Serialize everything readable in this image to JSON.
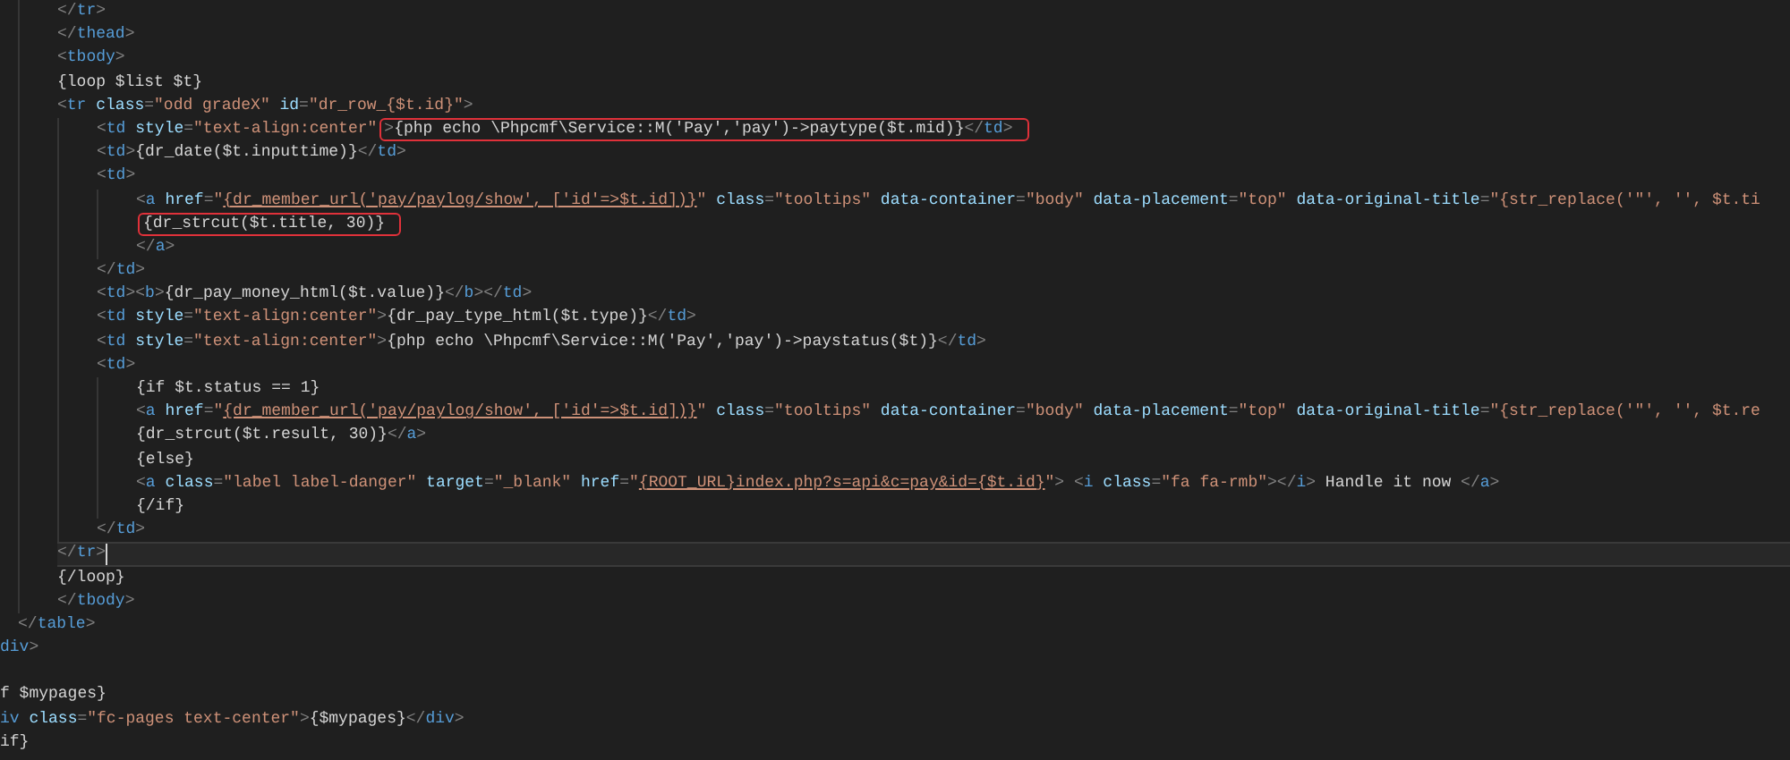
{
  "editor": {
    "lines": [
      {
        "children": [
          {
            "children": [
              {
                "current": false,
                "parts": [
                  {
                    "kind": "punct",
                    "text": "</"
                  },
                  {
                    "kind": "tag",
                    "text": "tr"
                  },
                  {
                    "kind": "punct",
                    "text": ">"
                  }
                ]
              },
              {
                "current": false,
                "parts": [
                  {
                    "kind": "punct",
                    "text": "</"
                  },
                  {
                    "kind": "tag",
                    "text": "thead"
                  },
                  {
                    "kind": "punct",
                    "text": ">"
                  }
                ]
              },
              {
                "current": false,
                "parts": [
                  {
                    "kind": "punct",
                    "text": "<"
                  },
                  {
                    "kind": "tag",
                    "text": "tbody"
                  },
                  {
                    "kind": "punct",
                    "text": ">"
                  }
                ]
              },
              {
                "current": false,
                "parts": [
                  {
                    "kind": "text",
                    "text": "{loop $list $t}"
                  }
                ]
              },
              {
                "current": false,
                "parts": [
                  {
                    "kind": "punct",
                    "text": "<"
                  },
                  {
                    "kind": "tag",
                    "text": "tr"
                  },
                  {
                    "kind": "attr",
                    "text": " class"
                  },
                  {
                    "kind": "punct",
                    "text": "="
                  },
                  {
                    "kind": "string",
                    "text": "\"odd gradeX\""
                  },
                  {
                    "kind": "attr",
                    "text": " id"
                  },
                  {
                    "kind": "punct",
                    "text": "="
                  },
                  {
                    "kind": "string",
                    "text": "\"dr_row_{$t.id}\""
                  },
                  {
                    "kind": "punct",
                    "text": ">"
                  }
                ],
                "children": [
                  {
                    "current": false,
                    "parts": [
                      {
                        "kind": "punct",
                        "text": "<"
                      },
                      {
                        "kind": "tag",
                        "text": "td"
                      },
                      {
                        "kind": "attr",
                        "text": " style"
                      },
                      {
                        "kind": "punct",
                        "text": "="
                      },
                      {
                        "kind": "string",
                        "text": "\"text-align:center\""
                      },
                      {
                        "kind": "marked",
                        "parts": [
                          {
                            "kind": "punct",
                            "text": ">"
                          },
                          {
                            "kind": "text",
                            "text": "{php echo \\Phpcmf\\Service::M('Pay','pay')->paytype($t.mid)}"
                          },
                          {
                            "kind": "punct",
                            "text": "</"
                          },
                          {
                            "kind": "tag",
                            "text": "td"
                          },
                          {
                            "kind": "punct",
                            "text": ">"
                          }
                        ]
                      }
                    ]
                  },
                  {
                    "current": false,
                    "parts": [
                      {
                        "kind": "punct",
                        "text": "<"
                      },
                      {
                        "kind": "tag",
                        "text": "td"
                      },
                      {
                        "kind": "punct",
                        "text": ">"
                      },
                      {
                        "kind": "text",
                        "text": "{dr_date($t.inputtime)}"
                      },
                      {
                        "kind": "punct",
                        "text": "</"
                      },
                      {
                        "kind": "tag",
                        "text": "td"
                      },
                      {
                        "kind": "punct",
                        "text": ">"
                      }
                    ]
                  },
                  {
                    "current": false,
                    "parts": [
                      {
                        "kind": "punct",
                        "text": "<"
                      },
                      {
                        "kind": "tag",
                        "text": "td"
                      },
                      {
                        "kind": "punct",
                        "text": ">"
                      }
                    ],
                    "children": [
                      {
                        "current": false,
                        "parts": [
                          {
                            "kind": "punct",
                            "text": "<"
                          },
                          {
                            "kind": "tag",
                            "text": "a"
                          },
                          {
                            "kind": "attr",
                            "text": " href"
                          },
                          {
                            "kind": "punct",
                            "text": "="
                          },
                          {
                            "kind": "string",
                            "text": "\""
                          },
                          {
                            "kind": "link",
                            "text": "{dr_member_url('pay/paylog/show', ['id'=>$t.id])}"
                          },
                          {
                            "kind": "string",
                            "text": "\""
                          },
                          {
                            "kind": "attr",
                            "text": " class"
                          },
                          {
                            "kind": "punct",
                            "text": "="
                          },
                          {
                            "kind": "string",
                            "text": "\"tooltips\""
                          },
                          {
                            "kind": "attr",
                            "text": " data-container"
                          },
                          {
                            "kind": "punct",
                            "text": "="
                          },
                          {
                            "kind": "string",
                            "text": "\"body\""
                          },
                          {
                            "kind": "attr",
                            "text": " data-placement"
                          },
                          {
                            "kind": "punct",
                            "text": "="
                          },
                          {
                            "kind": "string",
                            "text": "\"top\""
                          },
                          {
                            "kind": "attr",
                            "text": " data-original-title"
                          },
                          {
                            "kind": "punct",
                            "text": "="
                          },
                          {
                            "kind": "string",
                            "text": "\"{str_replace('\"', '', $t.ti"
                          }
                        ]
                      },
                      {
                        "current": false,
                        "parts": [
                          {
                            "kind": "marked",
                            "parts": [
                              {
                                "kind": "text",
                                "text": "{dr_strcut($t.title, 30)}"
                              }
                            ]
                          }
                        ]
                      },
                      {
                        "current": false,
                        "parts": [
                          {
                            "kind": "punct",
                            "text": "</"
                          },
                          {
                            "kind": "tag",
                            "text": "a"
                          },
                          {
                            "kind": "punct",
                            "text": ">"
                          }
                        ]
                      }
                    ]
                  },
                  {
                    "current": false,
                    "parts": [
                      {
                        "kind": "punct",
                        "text": "</"
                      },
                      {
                        "kind": "tag",
                        "text": "td"
                      },
                      {
                        "kind": "punct",
                        "text": ">"
                      }
                    ]
                  },
                  {
                    "current": false,
                    "parts": [
                      {
                        "kind": "punct",
                        "text": "<"
                      },
                      {
                        "kind": "tag",
                        "text": "td"
                      },
                      {
                        "kind": "punct",
                        "text": "><"
                      },
                      {
                        "kind": "tag",
                        "text": "b"
                      },
                      {
                        "kind": "punct",
                        "text": ">"
                      },
                      {
                        "kind": "text",
                        "text": "{dr_pay_money_html($t.value)}"
                      },
                      {
                        "kind": "punct",
                        "text": "</"
                      },
                      {
                        "kind": "tag",
                        "text": "b"
                      },
                      {
                        "kind": "punct",
                        "text": "></"
                      },
                      {
                        "kind": "tag",
                        "text": "td"
                      },
                      {
                        "kind": "punct",
                        "text": ">"
                      }
                    ]
                  },
                  {
                    "current": false,
                    "parts": [
                      {
                        "kind": "punct",
                        "text": "<"
                      },
                      {
                        "kind": "tag",
                        "text": "td"
                      },
                      {
                        "kind": "attr",
                        "text": " style"
                      },
                      {
                        "kind": "punct",
                        "text": "="
                      },
                      {
                        "kind": "string",
                        "text": "\"text-align:center\""
                      },
                      {
                        "kind": "punct",
                        "text": ">"
                      },
                      {
                        "kind": "text",
                        "text": "{dr_pay_type_html($t.type)}"
                      },
                      {
                        "kind": "punct",
                        "text": "</"
                      },
                      {
                        "kind": "tag",
                        "text": "td"
                      },
                      {
                        "kind": "punct",
                        "text": ">"
                      }
                    ]
                  },
                  {
                    "current": false,
                    "parts": [
                      {
                        "kind": "punct",
                        "text": "<"
                      },
                      {
                        "kind": "tag",
                        "text": "td"
                      },
                      {
                        "kind": "attr",
                        "text": " style"
                      },
                      {
                        "kind": "punct",
                        "text": "="
                      },
                      {
                        "kind": "string",
                        "text": "\"text-align:center\""
                      },
                      {
                        "kind": "punct",
                        "text": ">"
                      },
                      {
                        "kind": "text",
                        "text": "{php echo \\Phpcmf\\Service::M('Pay','pay')->paystatus($t)}"
                      },
                      {
                        "kind": "punct",
                        "text": "</"
                      },
                      {
                        "kind": "tag",
                        "text": "td"
                      },
                      {
                        "kind": "punct",
                        "text": ">"
                      }
                    ]
                  },
                  {
                    "current": false,
                    "parts": [
                      {
                        "kind": "punct",
                        "text": "<"
                      },
                      {
                        "kind": "tag",
                        "text": "td"
                      },
                      {
                        "kind": "punct",
                        "text": ">"
                      }
                    ],
                    "children": [
                      {
                        "current": false,
                        "parts": [
                          {
                            "kind": "text",
                            "text": "{if $t.status == 1}"
                          }
                        ]
                      },
                      {
                        "current": false,
                        "parts": [
                          {
                            "kind": "punct",
                            "text": "<"
                          },
                          {
                            "kind": "tag",
                            "text": "a"
                          },
                          {
                            "kind": "attr",
                            "text": " href"
                          },
                          {
                            "kind": "punct",
                            "text": "="
                          },
                          {
                            "kind": "string",
                            "text": "\""
                          },
                          {
                            "kind": "link",
                            "text": "{dr_member_url('pay/paylog/show', ['id'=>$t.id])}"
                          },
                          {
                            "kind": "string",
                            "text": "\""
                          },
                          {
                            "kind": "attr",
                            "text": " class"
                          },
                          {
                            "kind": "punct",
                            "text": "="
                          },
                          {
                            "kind": "string",
                            "text": "\"tooltips\""
                          },
                          {
                            "kind": "attr",
                            "text": " data-container"
                          },
                          {
                            "kind": "punct",
                            "text": "="
                          },
                          {
                            "kind": "string",
                            "text": "\"body\""
                          },
                          {
                            "kind": "attr",
                            "text": " data-placement"
                          },
                          {
                            "kind": "punct",
                            "text": "="
                          },
                          {
                            "kind": "string",
                            "text": "\"top\""
                          },
                          {
                            "kind": "attr",
                            "text": " data-original-title"
                          },
                          {
                            "kind": "punct",
                            "text": "="
                          },
                          {
                            "kind": "string",
                            "text": "\"{str_replace('\"', '', $t.re"
                          }
                        ]
                      },
                      {
                        "current": false,
                        "parts": [
                          {
                            "kind": "text",
                            "text": "{dr_strcut($t.result, 30)}"
                          },
                          {
                            "kind": "punct",
                            "text": "</"
                          },
                          {
                            "kind": "tag",
                            "text": "a"
                          },
                          {
                            "kind": "punct",
                            "text": ">"
                          }
                        ]
                      },
                      {
                        "current": false,
                        "parts": [
                          {
                            "kind": "text",
                            "text": "{else}"
                          }
                        ]
                      },
                      {
                        "current": false,
                        "parts": [
                          {
                            "kind": "punct",
                            "text": "<"
                          },
                          {
                            "kind": "tag",
                            "text": "a"
                          },
                          {
                            "kind": "attr",
                            "text": " class"
                          },
                          {
                            "kind": "punct",
                            "text": "="
                          },
                          {
                            "kind": "string",
                            "text": "\"label label-danger\""
                          },
                          {
                            "kind": "attr",
                            "text": " target"
                          },
                          {
                            "kind": "punct",
                            "text": "="
                          },
                          {
                            "kind": "string",
                            "text": "\"_blank\""
                          },
                          {
                            "kind": "attr",
                            "text": " href"
                          },
                          {
                            "kind": "punct",
                            "text": "="
                          },
                          {
                            "kind": "string",
                            "text": "\""
                          },
                          {
                            "kind": "link",
                            "text": "{ROOT_URL}index.php?s=api&c=pay&id={$t.id}"
                          },
                          {
                            "kind": "string",
                            "text": "\""
                          },
                          {
                            "kind": "punct",
                            "text": "> <"
                          },
                          {
                            "kind": "tag",
                            "text": "i"
                          },
                          {
                            "kind": "attr",
                            "text": " class"
                          },
                          {
                            "kind": "punct",
                            "text": "="
                          },
                          {
                            "kind": "string",
                            "text": "\"fa fa-rmb\""
                          },
                          {
                            "kind": "punct",
                            "text": "></"
                          },
                          {
                            "kind": "tag",
                            "text": "i"
                          },
                          {
                            "kind": "punct",
                            "text": ">"
                          },
                          {
                            "kind": "text",
                            "text": " Handle it now "
                          },
                          {
                            "kind": "punct",
                            "text": "</"
                          },
                          {
                            "kind": "tag",
                            "text": "a"
                          },
                          {
                            "kind": "punct",
                            "text": ">"
                          }
                        ]
                      },
                      {
                        "current": false,
                        "parts": [
                          {
                            "kind": "text",
                            "text": "{/if}"
                          }
                        ]
                      }
                    ]
                  },
                  {
                    "current": false,
                    "parts": [
                      {
                        "kind": "punct",
                        "text": "</"
                      },
                      {
                        "kind": "tag",
                        "text": "td"
                      },
                      {
                        "kind": "punct",
                        "text": ">"
                      }
                    ]
                  }
                ]
              },
              {
                "current": true,
                "parts": [
                  {
                    "kind": "punct",
                    "text": "</"
                  },
                  {
                    "kind": "tag",
                    "text": "tr"
                  },
                  {
                    "kind": "punct",
                    "text": ">"
                  }
                ]
              },
              {
                "current": false,
                "parts": [
                  {
                    "kind": "text",
                    "text": "{/loop}"
                  }
                ]
              },
              {
                "current": false,
                "parts": [
                  {
                    "kind": "punct",
                    "text": "</"
                  },
                  {
                    "kind": "tag",
                    "text": "tbody"
                  },
                  {
                    "kind": "punct",
                    "text": ">"
                  }
                ]
              }
            ]
          },
          {
            "current": false,
            "parts": [
              {
                "kind": "punct",
                "text": "</"
              },
              {
                "kind": "tag",
                "text": "table"
              },
              {
                "kind": "punct",
                "text": ">"
              }
            ]
          }
        ]
      },
      {
        "current": false,
        "parts": [
          {
            "kind": "tag",
            "text": "div"
          },
          {
            "kind": "punct",
            "text": ">"
          }
        ]
      },
      {
        "current": false
      },
      {
        "current": false,
        "parts": [
          {
            "kind": "text",
            "text": "f $mypages}"
          }
        ]
      },
      {
        "current": false,
        "parts": [
          {
            "kind": "tag",
            "text": "iv"
          },
          {
            "kind": "attr",
            "text": " class"
          },
          {
            "kind": "punct",
            "text": "="
          },
          {
            "kind": "string",
            "text": "\"fc-pages text-center\""
          },
          {
            "kind": "punct",
            "text": ">"
          },
          {
            "kind": "text",
            "text": "{$mypages}"
          },
          {
            "kind": "punct",
            "text": "</"
          },
          {
            "kind": "tag",
            "text": "div"
          },
          {
            "kind": "punct",
            "text": ">"
          }
        ]
      },
      {
        "current": false,
        "parts": [
          {
            "kind": "text",
            "text": "if}"
          }
        ]
      }
    ]
  }
}
